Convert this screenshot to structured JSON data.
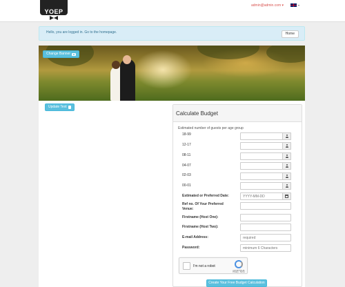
{
  "brand": {
    "logo_text": "YOEP"
  },
  "header": {
    "user_email": "admin@admin.com",
    "user_caret": "▾",
    "language_caret": "▾"
  },
  "alert": {
    "message": "Hello, you are logged in. Go to the homepage.",
    "home_label": "Home"
  },
  "banner": {
    "change_label": "Change Banner"
  },
  "update_text": {
    "label": "Update Text"
  },
  "budget": {
    "title": "Calculate Budget",
    "guests_heading": "Estimated number of guests per age group",
    "age_groups": [
      "18-99",
      "12-17",
      "08-11",
      "04-07",
      "02-03",
      "00-01"
    ],
    "date_label": "Estimated or Preferred Date:",
    "date_placeholder": "YYYY-MM-DD",
    "venue_label": "Ref no. Of Your Preferred Venue:",
    "host_one_label": "Firstname (Host One):",
    "host_two_label": "Firstname (Host Two):",
    "email_label": "E-mail Address:",
    "email_placeholder": "required",
    "password_label": "Password:",
    "password_placeholder": "minimum 6 Characters",
    "captcha_label": "I'm not a robot",
    "captcha_brand": "reCAPTCHA",
    "captcha_links": "Privacy - Terms",
    "submit_label": "Create Your Free Budget Calculation"
  },
  "colors": {
    "accent": "#5bc0de",
    "alert_bg": "#d9edf7",
    "alert_text": "#31708f",
    "user_link": "#d9534f"
  },
  "icons": [
    "user-icon",
    "calendar-icon",
    "camera-icon",
    "document-icon",
    "uk-flag-icon",
    "recaptcha-icon"
  ]
}
